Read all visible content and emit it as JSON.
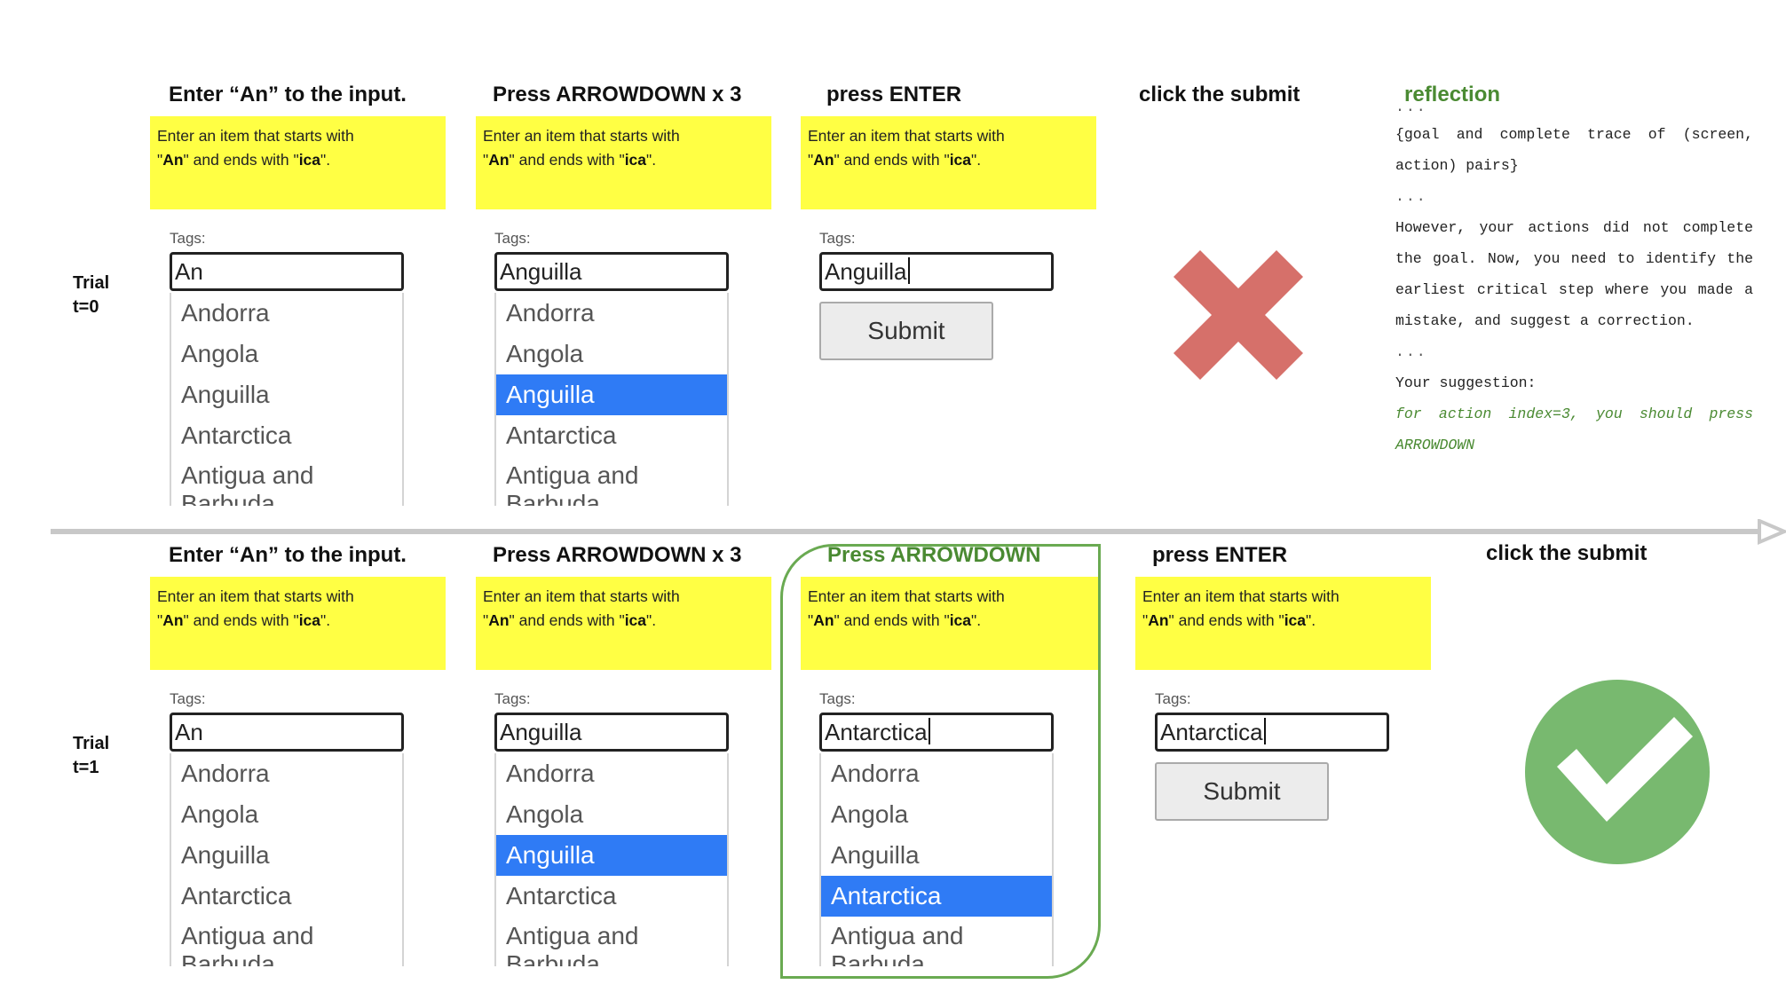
{
  "task": {
    "line1": "Enter an item that starts with",
    "line2_prefix": "\"",
    "line2_bold1": "An",
    "line2_mid": "\" and ends with \"",
    "line2_bold2": "ica",
    "line2_suffix": "\"."
  },
  "tags_label": "Tags:",
  "submit_label": "Submit",
  "countries": [
    "Andorra",
    "Angola",
    "Anguilla",
    "Antarctica",
    "Antigua and Barbuda"
  ],
  "colors": {
    "task_bg": "#ffff44",
    "selected": "#2f7bf5",
    "fail": "#d6706a",
    "success": "#78b96f",
    "highlight": "#4a8a32"
  },
  "trials": [
    {
      "label_line1": "Trial",
      "label_line2": "t=0",
      "steps": [
        {
          "title": "Enter “An” to the input.",
          "input": "An",
          "caret": false,
          "list": true,
          "selected": null
        },
        {
          "title": "Press ARROWDOWN x 3",
          "input": "Anguilla",
          "caret": false,
          "list": true,
          "selected": 2
        },
        {
          "title": "press ENTER",
          "input": "Anguilla",
          "caret": true,
          "list": false,
          "submit": true
        },
        {
          "title": "click the submit",
          "result": "fail-icon"
        }
      ]
    },
    {
      "label_line1": "Trial",
      "label_line2": "t=1",
      "steps": [
        {
          "title": "Enter “An” to the input.",
          "input": "An",
          "caret": false,
          "list": true,
          "selected": null
        },
        {
          "title": "Press ARROWDOWN x 3",
          "input": "Anguilla",
          "caret": false,
          "list": true,
          "selected": 2
        },
        {
          "title": "Press ARROWDOWN",
          "input": "Antarctica",
          "caret": true,
          "list": true,
          "selected": 3,
          "highlighted": true
        },
        {
          "title": "press ENTER",
          "input": "Antarctica",
          "caret": true,
          "list": false,
          "submit": true
        },
        {
          "title": "click the submit",
          "result": "success-icon"
        }
      ]
    }
  ],
  "reflection": {
    "title": "reflection",
    "ellipsis": "...",
    "trace_text": "{goal and complete trace of (screen, action) pairs}",
    "instruction_text": "However, your actions did not complete the goal. Now, you need to identify the earliest critical step where you made a mistake, and suggest a correction.",
    "suggestion_label": "Your suggestion:",
    "suggestion_text": "for action index=3, you should press ARROWDOWN"
  }
}
